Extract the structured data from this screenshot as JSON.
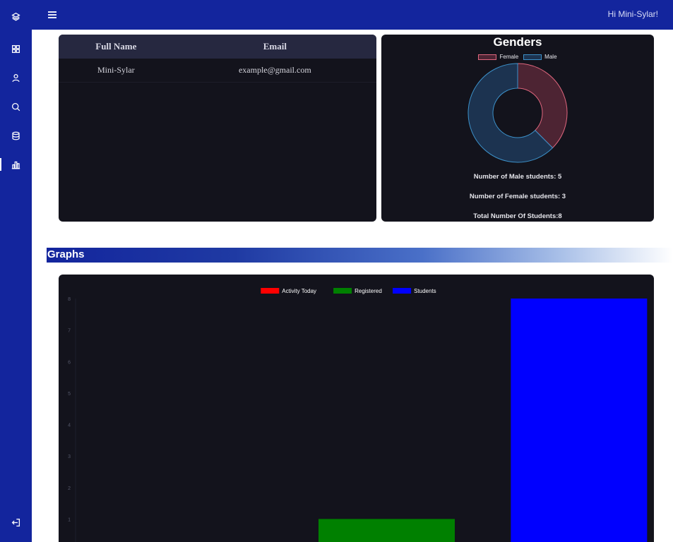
{
  "header": {
    "greeting": "Hi Mini-Sylar!"
  },
  "sidebar": {
    "items": [
      {
        "icon": "layers-icon"
      },
      {
        "icon": "dashboard-grid-icon"
      },
      {
        "icon": "user-icon"
      },
      {
        "icon": "search-icon"
      },
      {
        "icon": "database-icon"
      },
      {
        "icon": "bar-chart-icon",
        "active": true
      }
    ],
    "logout_icon": "logout-icon"
  },
  "users_table": {
    "columns": [
      "Full Name",
      "Email"
    ],
    "rows": [
      {
        "full_name": "Mini-Sylar",
        "email": "example@gmail.com"
      }
    ]
  },
  "genders": {
    "title": "Genders",
    "legend": [
      {
        "label": "Female",
        "color": "#e0677e"
      },
      {
        "label": "Male",
        "color": "#3c90c8"
      }
    ],
    "male_stat": "Number of Male students: 5",
    "female_stat": "Number of Female students: 3",
    "total_stat": "Total Number Of Students:8"
  },
  "graphs": {
    "title": "Graphs"
  },
  "chart_data": [
    {
      "type": "pie",
      "title": "Genders",
      "labels": [
        "Female",
        "Male"
      ],
      "values": [
        3,
        5
      ],
      "colors": [
        "#e0677e",
        "#3c90c8"
      ],
      "legend": "top"
    },
    {
      "type": "bar",
      "categories": [
        "Activity Today",
        "Registered",
        "Students"
      ],
      "series": [
        {
          "name": "Activity Today",
          "values": [
            0,
            0,
            0
          ],
          "color": "#ff0000"
        },
        {
          "name": "Registered",
          "values": [
            0,
            1,
            0
          ],
          "color": "#008000"
        },
        {
          "name": "Students",
          "values": [
            0,
            0,
            8
          ],
          "color": "#0000ff"
        }
      ],
      "y_ticks": [
        "8",
        "7",
        "6",
        "5",
        "4",
        "3",
        "2",
        "1"
      ],
      "ylim": [
        0,
        8
      ],
      "legend": "top"
    }
  ]
}
